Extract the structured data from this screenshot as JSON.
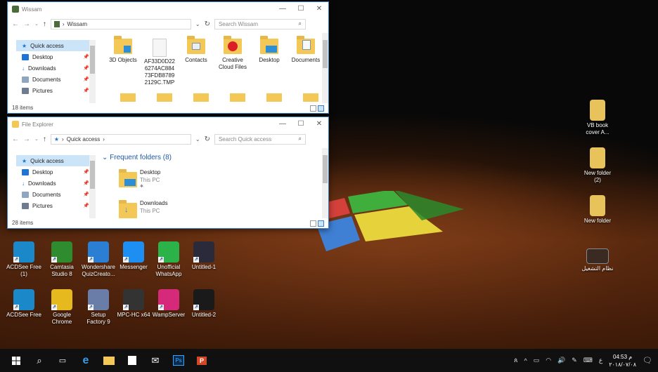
{
  "window1": {
    "title": "Wissam",
    "path": "Wissam",
    "search_placeholder": "Search Wissam",
    "status": "18 items",
    "nav": [
      {
        "label": "Quick access",
        "color": "#1e74d4"
      },
      {
        "label": "Desktop",
        "color": "#1e74d4"
      },
      {
        "label": "Downloads",
        "color": "#1e74d4"
      },
      {
        "label": "Documents",
        "color": "#8fa6c0"
      },
      {
        "label": "Pictures",
        "color": "#6b7d8f"
      }
    ],
    "files": [
      {
        "name": "3D Objects",
        "icon": "folder-3d-icon"
      },
      {
        "name": "AF33D0D226274AC88473FDB87892129C.TMP",
        "l1": "AF33D0D22",
        "l2": "6274AC884",
        "l3": "73FDB8789",
        "l4": "2129C.TMP",
        "icon": "file-icon"
      },
      {
        "name": "Contacts",
        "icon": "folder-contacts-icon"
      },
      {
        "name": "Creative Cloud Files",
        "l1": "Creative",
        "l2": "Cloud Files",
        "icon": "creative-cloud-folder-icon"
      },
      {
        "name": "Desktop",
        "icon": "folder-desktop-icon"
      },
      {
        "name": "Documents",
        "icon": "folder-documents-icon"
      }
    ]
  },
  "window2": {
    "title": "File Explorer",
    "path": "Quick access",
    "search_placeholder": "Search Quick access",
    "status": "28 items",
    "section": "Frequent folders (8)",
    "nav": [
      {
        "label": "Quick access"
      },
      {
        "label": "Desktop"
      },
      {
        "label": "Downloads"
      },
      {
        "label": "Documents"
      },
      {
        "label": "Pictures"
      }
    ],
    "frequent": [
      {
        "name": "Desktop",
        "sub": "This PC"
      },
      {
        "name": "Downloads",
        "sub": "This PC"
      }
    ]
  },
  "desktop_left": [
    {
      "label": "ACDSee Free (1)",
      "l1": "ACDSee Free",
      "l2": "(1)",
      "color": "#1b88c9",
      "icon": "acdsee-icon"
    },
    {
      "label": "Camtasia Studio 8",
      "l1": "Camtasia",
      "l2": "Studio 8",
      "color": "#2e8b2e",
      "icon": "camtasia-icon"
    },
    {
      "label": "Wondershare QuizCreato...",
      "l1": "Wondershare",
      "l2": "QuizCreato...",
      "color": "#2a7fd4",
      "icon": "quizcreator-icon"
    },
    {
      "label": "Messenger",
      "l1": "Messenger",
      "l2": "",
      "color": "#1d8ff2",
      "icon": "messenger-icon"
    },
    {
      "label": "Unofficial WhatsApp",
      "l1": "Unofficial",
      "l2": "WhatsApp",
      "color": "#2bb34a",
      "icon": "whatsapp-icon"
    },
    {
      "label": "Untitled-1",
      "l1": "Untitled-1",
      "l2": "",
      "color": "#2a2a3a",
      "icon": "image-file-icon"
    },
    {
      "label": "ACDSee Free",
      "l1": "ACDSee Free",
      "l2": "",
      "color": "#1b88c9",
      "icon": "acdsee-icon"
    },
    {
      "label": "Google Chrome",
      "l1": "Google",
      "l2": "Chrome",
      "color": "#e6b91e",
      "icon": "chrome-icon"
    },
    {
      "label": "Setup Factory 9",
      "l1": "Setup",
      "l2": "Factory 9",
      "color": "#6a7da8",
      "icon": "setup-factory-icon"
    },
    {
      "label": "MPC-HC x64",
      "l1": "MPC-HC x64",
      "l2": "",
      "color": "#333",
      "icon": "mpc-hc-icon"
    },
    {
      "label": "WampServer",
      "l1": "WampServer",
      "l2": "",
      "color": "#d6297a",
      "icon": "wampserver-icon"
    },
    {
      "label": "Untitled-2",
      "l1": "Untitled-2",
      "l2": "",
      "color": "#1a1a1a",
      "icon": "image-file-icon"
    }
  ],
  "desktop_right": [
    {
      "label": "VB book cover A...",
      "l1": "VB book",
      "l2": "cover A...",
      "icon": "folder-icon"
    },
    {
      "label": "New folder (2)",
      "l1": "New folder",
      "l2": "(2)",
      "icon": "folder-icon"
    },
    {
      "label": "New folder",
      "l1": "New folder",
      "l2": "",
      "icon": "folder-icon"
    },
    {
      "label": "نظام التشغيل",
      "l1": "نظام التشغيل",
      "l2": "",
      "icon": "powerpoint-file-icon"
    }
  ],
  "taskbar": {
    "icons": [
      "windows-start-icon",
      "search-icon",
      "task-view-icon",
      "edge-icon",
      "file-explorer-icon",
      "store-icon",
      "mail-icon",
      "photoshop-icon",
      "powerpoint-icon"
    ],
    "ps_label": "Ps",
    "ppt_label": "P",
    "lang": "ع",
    "time": "04:53",
    "ampm": "م",
    "date": "٢٠١٨/٠٧/٠٨"
  }
}
